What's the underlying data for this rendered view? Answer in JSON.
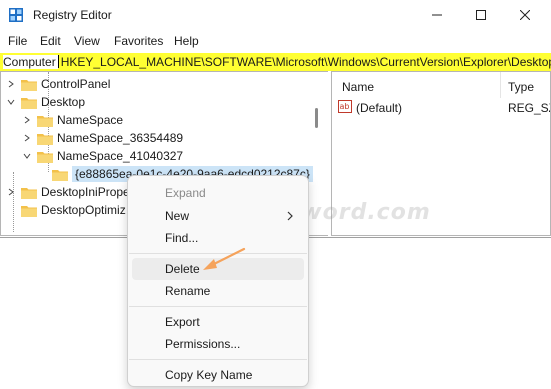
{
  "window": {
    "title": "Registry Editor",
    "controls": {
      "minimize": "—",
      "maximize": "☐",
      "close": "✕"
    }
  },
  "menubar": [
    "File",
    "Edit",
    "View",
    "Favorites",
    "Help"
  ],
  "address": {
    "prefix": "Computer",
    "path": "HKEY_LOCAL_MACHINE\\SOFTWARE\\Microsoft\\Windows\\CurrentVersion\\Explorer\\Desktop"
  },
  "tree": [
    {
      "label": "ControlPanel",
      "chevron": ">",
      "level": 1
    },
    {
      "label": "Desktop",
      "chevron": "v",
      "level": 1
    },
    {
      "label": "NameSpace",
      "chevron": ">",
      "level": 2
    },
    {
      "label": "NameSpace_36354489",
      "chevron": ">",
      "level": 2
    },
    {
      "label": "NameSpace_41040327",
      "chevron": "v",
      "level": 2
    },
    {
      "label": "{e88865ea-0e1c-4e20-9aa6-edcd0212c87c}",
      "chevron": "",
      "level": 3,
      "selected": true
    },
    {
      "label": "DesktopIniPrope",
      "chevron": ">",
      "level": 1
    },
    {
      "label": "DesktopOptimiz",
      "chevron": "",
      "level": 1
    }
  ],
  "list": {
    "headers": {
      "name": "Name",
      "type": "Type"
    },
    "rows": [
      {
        "name": "(Default)",
        "type": "REG_SZ",
        "icon": "ab-string-icon"
      }
    ]
  },
  "context_menu": {
    "items": [
      {
        "label": "Expand",
        "disabled": true
      },
      {
        "label": "New",
        "submenu": true
      },
      {
        "label": "Find..."
      },
      {
        "label": "Delete",
        "highlighted": true
      },
      {
        "label": "Rename"
      },
      {
        "label": "Export"
      },
      {
        "label": "Permissions..."
      },
      {
        "label": "Copy Key Name"
      }
    ],
    "submenu_arrow": "›"
  },
  "watermark": "top-password.com",
  "colors": {
    "address_highlight": "#ffff33",
    "selection": "#cce4f7",
    "folder": "#f3c14a",
    "annotation_arrow": "#f5a35c"
  }
}
